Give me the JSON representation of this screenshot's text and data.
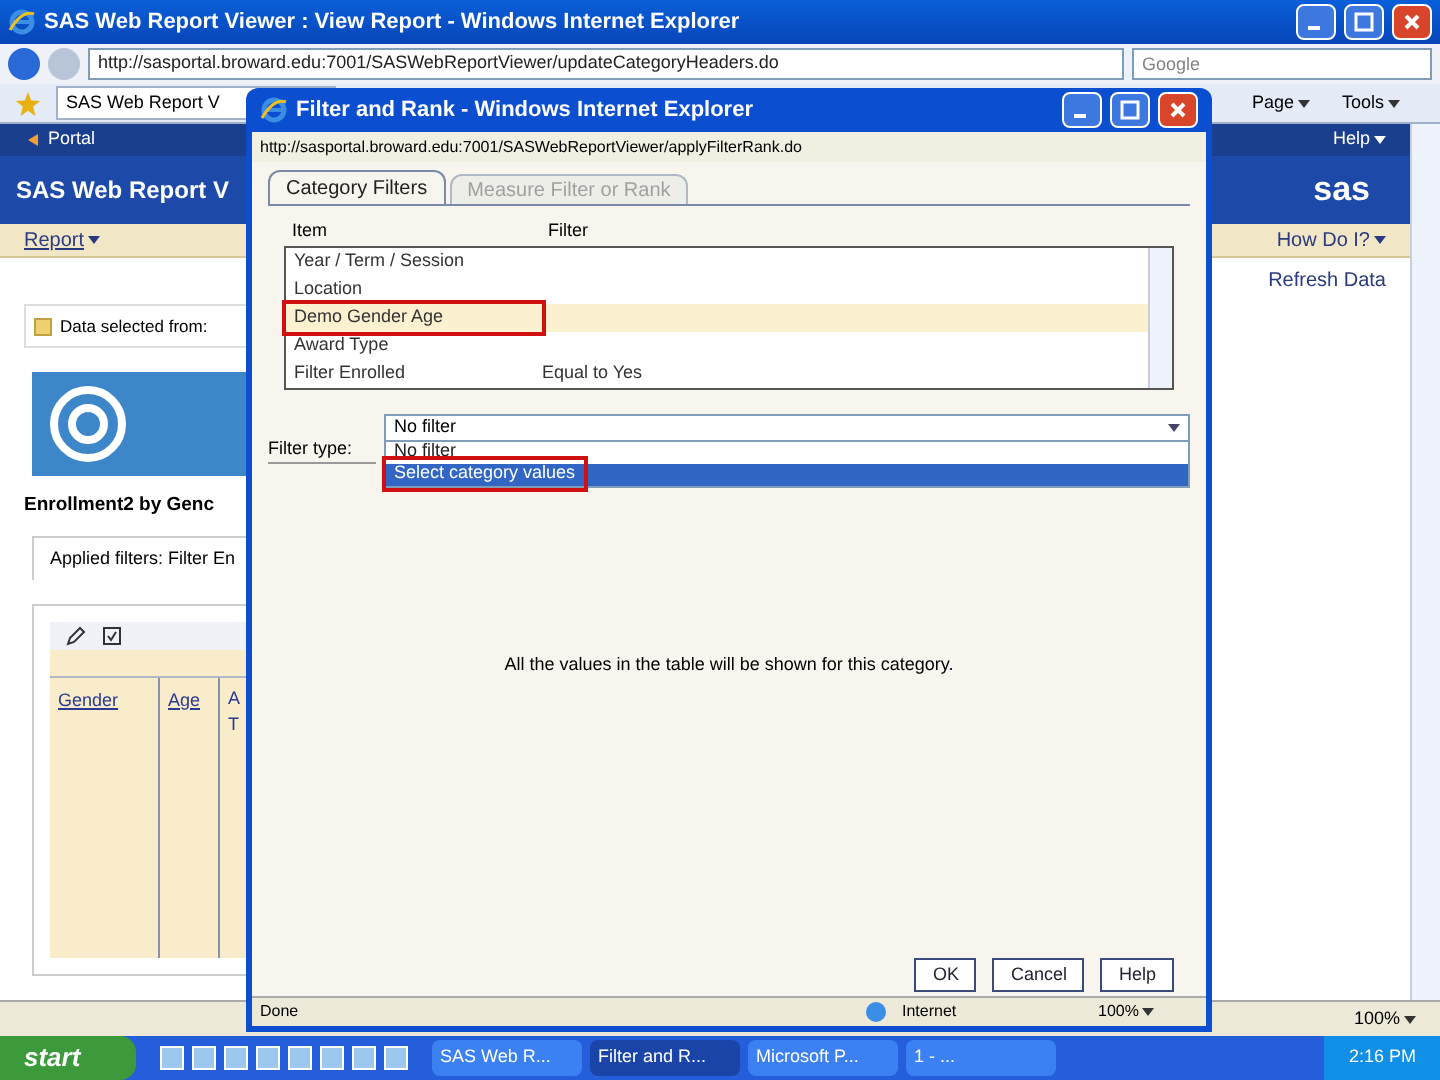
{
  "window": {
    "title": "SAS Web Report Viewer : View Report - Windows Internet Explorer"
  },
  "address_bar": {
    "url": "http://sasportal.broward.edu:7001/SASWebReportViewer/updateCategoryHeaders.do",
    "search_placeholder": "Google"
  },
  "browser_tab": {
    "label": "SAS Web Report V"
  },
  "command_bar": {
    "page": "Page",
    "tools": "Tools"
  },
  "portal_bar": {
    "back_link": "Portal",
    "help": "Help"
  },
  "banner": {
    "title": "SAS Web Report V",
    "logo": "sas"
  },
  "menu": {
    "report": "Report",
    "how_do_i": "How Do I?",
    "refresh": "Refresh Data"
  },
  "data_selected": "Data selected from:",
  "report_title": "Enrollment2 by Genc",
  "applied_filters": "Applied filters:  Filter En",
  "table": {
    "columns": [
      "Gender",
      "Age"
    ],
    "column_3": [
      "A",
      "T"
    ]
  },
  "status_bar": {
    "zoom": "100%"
  },
  "dialog": {
    "title": "Filter and Rank - Windows Internet Explorer",
    "url": "http://sasportal.broward.edu:7001/SASWebReportViewer/applyFilterRank.do",
    "tabs": [
      {
        "label": "Category Filters",
        "selected": true
      },
      {
        "label": "Measure Filter or Rank",
        "selected": false
      }
    ],
    "headers": [
      "Item",
      "Filter"
    ],
    "items": [
      {
        "item": "Year / Term / Session",
        "selected": false,
        "annotated": false
      },
      {
        "item": "Location",
        "selected": false,
        "annotated": false
      },
      {
        "item": "Demo Gender Age",
        "selected": true,
        "annotated": true
      },
      {
        "item": "Award Type",
        "selected": false,
        "annotated": false
      },
      {
        "item": "Filter Enrolled",
        "filter": "Equal to Yes",
        "selected": false,
        "annotated": false
      }
    ],
    "filter_type": {
      "label": "Filter type:",
      "value": "No filter",
      "options": [
        {
          "label": "No filter",
          "highlighted": false,
          "annotated": false
        },
        {
          "label": "Select category values",
          "highlighted": true,
          "annotated": true
        }
      ]
    },
    "message": "All the values in the table will be shown for this category.",
    "buttons": [
      "OK",
      "Cancel",
      "Help"
    ],
    "status": {
      "text": "Done",
      "zone": "Internet",
      "zoom": "100%"
    }
  },
  "taskbar": {
    "start": "start",
    "tasks": [
      {
        "label": "SAS Web R...",
        "selected": false
      },
      {
        "label": "Filter and R...",
        "selected": true
      },
      {
        "label": "Microsoft P...",
        "selected": false
      },
      {
        "label": "1 - ...",
        "selected": false
      }
    ],
    "clock": "2:16 PM"
  }
}
